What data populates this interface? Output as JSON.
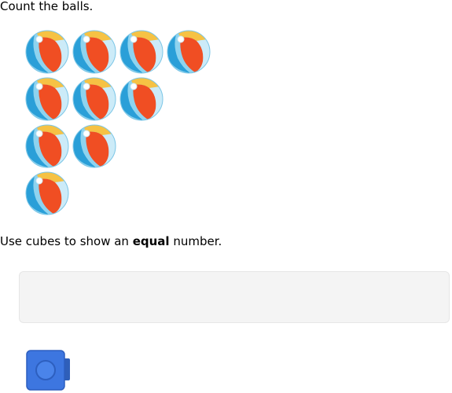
{
  "question": {
    "count_prompt": "Count the balls.",
    "instruction_before": "Use cubes to show an ",
    "instruction_bold": "equal",
    "instruction_after": " number."
  },
  "balls": {
    "rows": [
      4,
      3,
      2,
      1
    ],
    "total": 10,
    "icon": "beach-ball-icon"
  },
  "cubes": {
    "icon": "blue-cube-icon",
    "color": "#3d76e0",
    "placed": 0
  },
  "colors": {
    "ball_red": "#f04e23",
    "ball_blue": "#8ed3ef",
    "ball_yellow": "#f6c244",
    "drop_zone_bg": "#f4f4f4"
  }
}
